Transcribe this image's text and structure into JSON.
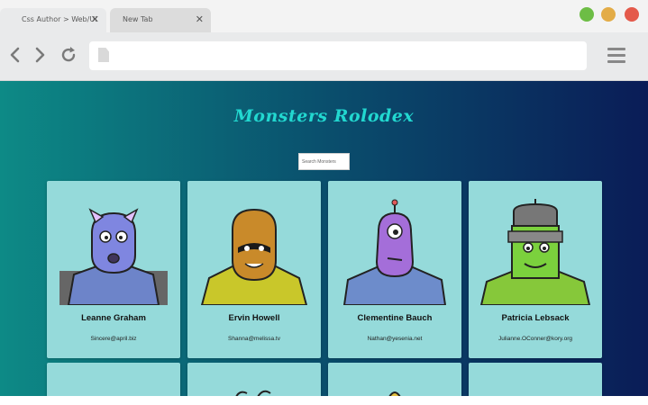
{
  "browser": {
    "tabs": [
      {
        "label": "Css Author > Web/Ui",
        "close": "✕"
      },
      {
        "label": "New Tab",
        "close": "✕"
      }
    ],
    "address": ""
  },
  "app": {
    "title": "Monsters Rolodex",
    "search_placeholder": "Search Monsters"
  },
  "monsters": [
    {
      "name": "Leanne Graham",
      "email": "Sincere@april.biz",
      "body_color": "#6d84c9",
      "skin_color": "#7f86e0"
    },
    {
      "name": "Ervin Howell",
      "email": "Shanna@melissa.tv",
      "body_color": "#c9c72a",
      "skin_color": "#c98a2a"
    },
    {
      "name": "Clementine Bauch",
      "email": "Nathan@yesenia.net",
      "body_color": "#6d8ccb",
      "skin_color": "#a46ed9"
    },
    {
      "name": "Patricia Lebsack",
      "email": "Julianne.OConner@kory.org",
      "body_color": "#86c83a",
      "skin_color": "#7bd13d"
    }
  ]
}
